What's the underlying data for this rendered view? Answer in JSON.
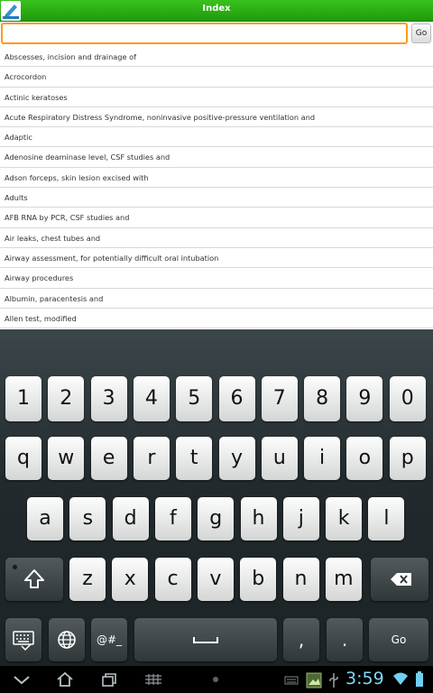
{
  "app": {
    "title": "Index"
  },
  "search": {
    "value": "",
    "placeholder": "",
    "go_label": "Go"
  },
  "list": [
    "Abscesses, incision and drainage of",
    "Acrocordon",
    "Actinic keratoses",
    "Acute Respiratory Distress Syndrome, noninvasive positive-pressure ventilation and",
    "Adaptic",
    "Adenosine deaminase level, CSF studies and",
    "Adson forceps, skin lesion excised with",
    "Adults",
    "AFB RNA by PCR, CSF studies and",
    "Air leaks, chest tubes and",
    "Airway assessment, for potentially difficult oral intubation",
    "Airway procedures",
    "Albumin, paracentesis and",
    "Allen test, modified"
  ],
  "keyboard": {
    "row_numbers": [
      "1",
      "2",
      "3",
      "4",
      "5",
      "6",
      "7",
      "8",
      "9",
      "0"
    ],
    "row_top": [
      "q",
      "w",
      "e",
      "r",
      "t",
      "y",
      "u",
      "i",
      "o",
      "p"
    ],
    "row_middle": [
      "a",
      "s",
      "d",
      "f",
      "g",
      "h",
      "j",
      "k",
      "l"
    ],
    "row_bottom": [
      "z",
      "x",
      "c",
      "v",
      "b",
      "n",
      "m"
    ],
    "symbols_label": "@#_",
    "go_label": "Go",
    "comma_label": ",",
    "period_label": "."
  },
  "status": {
    "clock": "3:59"
  },
  "colors": {
    "titlebar": "#2aae14",
    "search_border": "#ff9a1a",
    "clock": "#7fd8f7"
  }
}
